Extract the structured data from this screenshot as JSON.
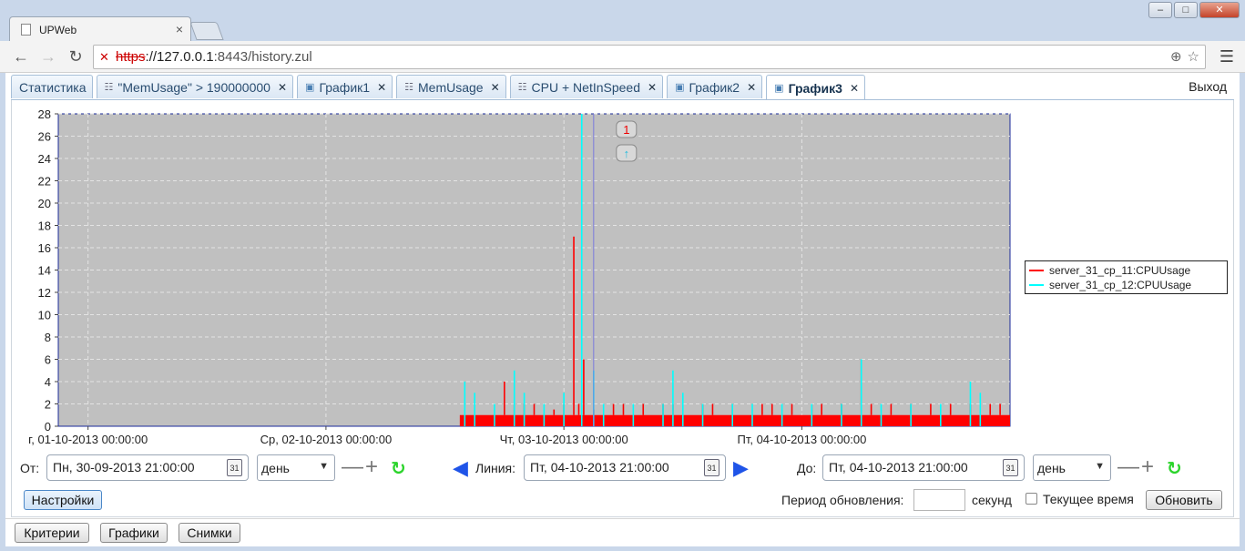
{
  "browser": {
    "tab_title": "UPWeb",
    "url_scheme": "https",
    "url_host": "://127.0.0.1",
    "url_rest": ":8443/history.zul"
  },
  "app_tabs": [
    {
      "label": "Статистика",
      "icon": "",
      "closable": false,
      "active": false
    },
    {
      "label": "\"MemUsage\" > 190000000",
      "icon": "table-icon",
      "closable": true,
      "active": false
    },
    {
      "label": "График1",
      "icon": "chart-icon",
      "closable": true,
      "active": false
    },
    {
      "label": "MemUsage",
      "icon": "table-icon",
      "closable": true,
      "active": false
    },
    {
      "label": "CPU + NetInSpeed",
      "icon": "table-icon",
      "closable": true,
      "active": false
    },
    {
      "label": "График2",
      "icon": "chart-icon",
      "closable": true,
      "active": false
    },
    {
      "label": "График3",
      "icon": "chart-icon",
      "closable": true,
      "active": true
    }
  ],
  "logout_label": "Выход",
  "chart_data": {
    "type": "line",
    "ylim": [
      0,
      28
    ],
    "y_ticks": [
      0,
      2,
      4,
      6,
      8,
      10,
      12,
      14,
      16,
      18,
      20,
      22,
      24,
      26,
      28
    ],
    "x_ticks": [
      "г, 01-10-2013 00:00:00",
      "Ср, 02-10-2013 00:00:00",
      "Чт, 03-10-2013 00:00:00",
      "Пт, 04-10-2013 00:00:00"
    ],
    "x_tick_hours": [
      3,
      27,
      51,
      75
    ],
    "xlim_hours": [
      0,
      96
    ],
    "grid": true,
    "legend_position": "right",
    "background": "#c0c0c0",
    "markers": [
      "1",
      "↑"
    ],
    "cursor_hour": 54,
    "series": [
      {
        "name": "server_31_cp_11:CPUUsage",
        "color": "#ff0000",
        "baseline": 1,
        "baseline_from_hour": 40.5,
        "spikes": [
          [
            45,
            4
          ],
          [
            46,
            2
          ],
          [
            47,
            2
          ],
          [
            48,
            2
          ],
          [
            50,
            1.5
          ],
          [
            51,
            2
          ],
          [
            52,
            17
          ],
          [
            52.5,
            2
          ],
          [
            53,
            6
          ],
          [
            54,
            1.5
          ],
          [
            56,
            2
          ],
          [
            57,
            2
          ],
          [
            59,
            2
          ],
          [
            61,
            2
          ],
          [
            62,
            2
          ],
          [
            65,
            2
          ],
          [
            66,
            2
          ],
          [
            68,
            2
          ],
          [
            71,
            2
          ],
          [
            72,
            2
          ],
          [
            74,
            2
          ],
          [
            76,
            2
          ],
          [
            77,
            2
          ],
          [
            79,
            2
          ],
          [
            81,
            6
          ],
          [
            82,
            2
          ],
          [
            84,
            2
          ],
          [
            86,
            2
          ],
          [
            88,
            2
          ],
          [
            90,
            2
          ],
          [
            92,
            2
          ],
          [
            94,
            2
          ],
          [
            95,
            2
          ]
        ]
      },
      {
        "name": "server_31_cp_12:CPUUsage",
        "color": "#00ffff",
        "baseline": 0,
        "baseline_from_hour": 40.5,
        "spikes": [
          [
            41,
            4
          ],
          [
            42,
            3
          ],
          [
            44,
            2
          ],
          [
            46,
            5
          ],
          [
            47,
            3
          ],
          [
            49,
            2
          ],
          [
            51,
            3
          ],
          [
            52.8,
            28
          ],
          [
            54,
            5
          ],
          [
            55,
            2
          ],
          [
            58,
            2
          ],
          [
            61,
            2
          ],
          [
            62,
            5
          ],
          [
            63,
            3
          ],
          [
            65,
            2
          ],
          [
            68,
            2
          ],
          [
            70,
            2
          ],
          [
            73,
            2
          ],
          [
            76,
            2
          ],
          [
            79,
            2
          ],
          [
            81,
            6
          ],
          [
            83,
            2
          ],
          [
            86,
            2
          ],
          [
            89,
            2
          ],
          [
            92,
            4
          ],
          [
            93,
            3
          ]
        ]
      }
    ]
  },
  "controls": {
    "from_label": "От:",
    "from_value": "Пн, 30-09-2013 21:00:00",
    "from_unit": "день",
    "line_label": "Линия:",
    "line_value": "Пт, 04-10-2013 21:00:00",
    "to_label": "До:",
    "to_value": "Пт, 04-10-2013 21:00:00",
    "to_unit": "день",
    "settings_label": "Настройки",
    "refresh_period_label": "Период обновления:",
    "refresh_period_value": "",
    "seconds_label": "секунд",
    "current_time_label": "Текущее время",
    "update_label": "Обновить",
    "calendar_text": "31"
  },
  "bottom_buttons": {
    "criteria": "Критерии",
    "charts": "Графики",
    "snapshots": "Снимки"
  }
}
